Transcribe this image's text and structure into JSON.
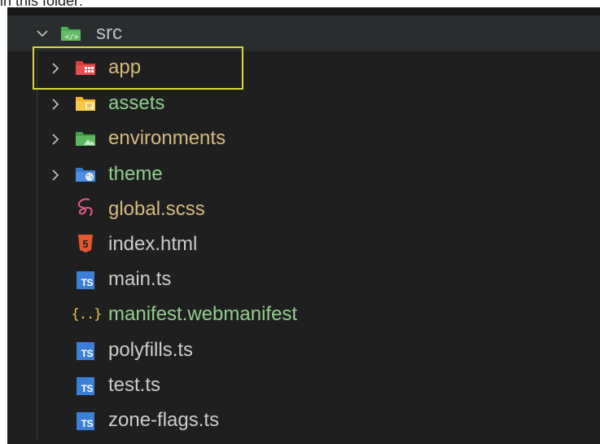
{
  "caption": "in this folder:",
  "explorer": {
    "root": {
      "name": "src",
      "expanded": true,
      "icon": "folder-src-icon",
      "color": "#b8c0c8"
    },
    "items": [
      {
        "name": "app",
        "kind": "folder",
        "icon": "folder-app-icon",
        "color": "#d7ba7d",
        "focused": true
      },
      {
        "name": "assets",
        "kind": "folder",
        "icon": "folder-assets-icon",
        "color": "#8fd08c"
      },
      {
        "name": "environments",
        "kind": "folder",
        "icon": "folder-environments-icon",
        "color": "#d7ba7d"
      },
      {
        "name": "theme",
        "kind": "folder",
        "icon": "folder-theme-icon",
        "color": "#8fd08c"
      },
      {
        "name": "global.scss",
        "kind": "file",
        "icon": "sass-icon",
        "color": "#d7ba7d"
      },
      {
        "name": "index.html",
        "kind": "file",
        "icon": "html5-icon",
        "color": "#cccccc"
      },
      {
        "name": "main.ts",
        "kind": "file",
        "icon": "typescript-icon",
        "color": "#cccccc"
      },
      {
        "name": "manifest.webmanifest",
        "kind": "file",
        "icon": "json-icon",
        "color": "#8fd08c"
      },
      {
        "name": "polyfills.ts",
        "kind": "file",
        "icon": "typescript-icon",
        "color": "#cccccc"
      },
      {
        "name": "test.ts",
        "kind": "file",
        "icon": "typescript-icon",
        "color": "#cccccc"
      },
      {
        "name": "zone-flags.ts",
        "kind": "file",
        "icon": "typescript-icon",
        "color": "#cccccc"
      }
    ],
    "ts_badge": "TS",
    "json_badge": "{..}",
    "html_badge": "5"
  }
}
